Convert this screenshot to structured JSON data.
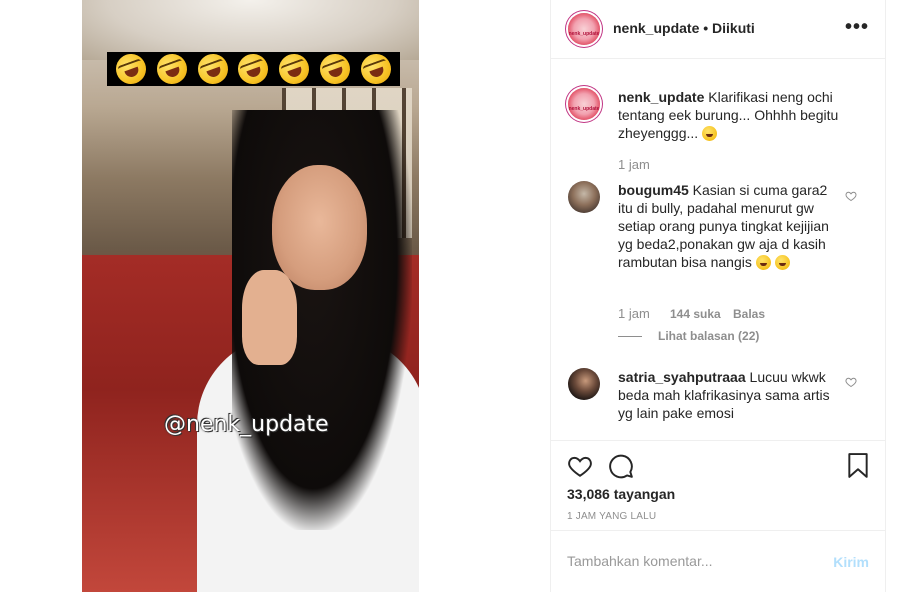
{
  "video": {
    "emoji_count": 7,
    "emoji_icon": "rolling-on-floor-laughing-emoji",
    "watermark": "@nenk_update"
  },
  "header": {
    "username": "nenk_update",
    "separator": " • ",
    "follow_status": "Diikuti",
    "more_icon": "•••",
    "avatar_text": "nenk_update"
  },
  "caption": {
    "username": "nenk_update",
    "text": "Klarifikasi neng ochi tentang eek burung... Ohhhh begitu zheyenggg...",
    "time": "1 jam"
  },
  "comments": [
    {
      "username": "bougum45",
      "text": "Kasian si cuma gara2 itu di bully, padahal menurut gw setiap orang punya tingkat kejijian yg beda2,ponakan gw aja d kasih rambutan bisa nangis",
      "time": "1 jam",
      "likes": "144 suka",
      "reply": "Balas",
      "view_replies": "Lihat balasan (22)"
    },
    {
      "username": "satria_syahputraaa",
      "text": "Lucuu wkwk beda mah klafrikasinya sama artis yg lain pake emosi"
    }
  ],
  "stats": {
    "views": "33,086",
    "views_label": "tayangan",
    "time_ago": "1 JAM YANG LALU"
  },
  "comment_form": {
    "placeholder": "Tambahkan komentar...",
    "post_label": "Kirim"
  },
  "colors": {
    "accent_light": "#b2dffc",
    "muted": "#8e8e8e",
    "text": "#262626"
  }
}
